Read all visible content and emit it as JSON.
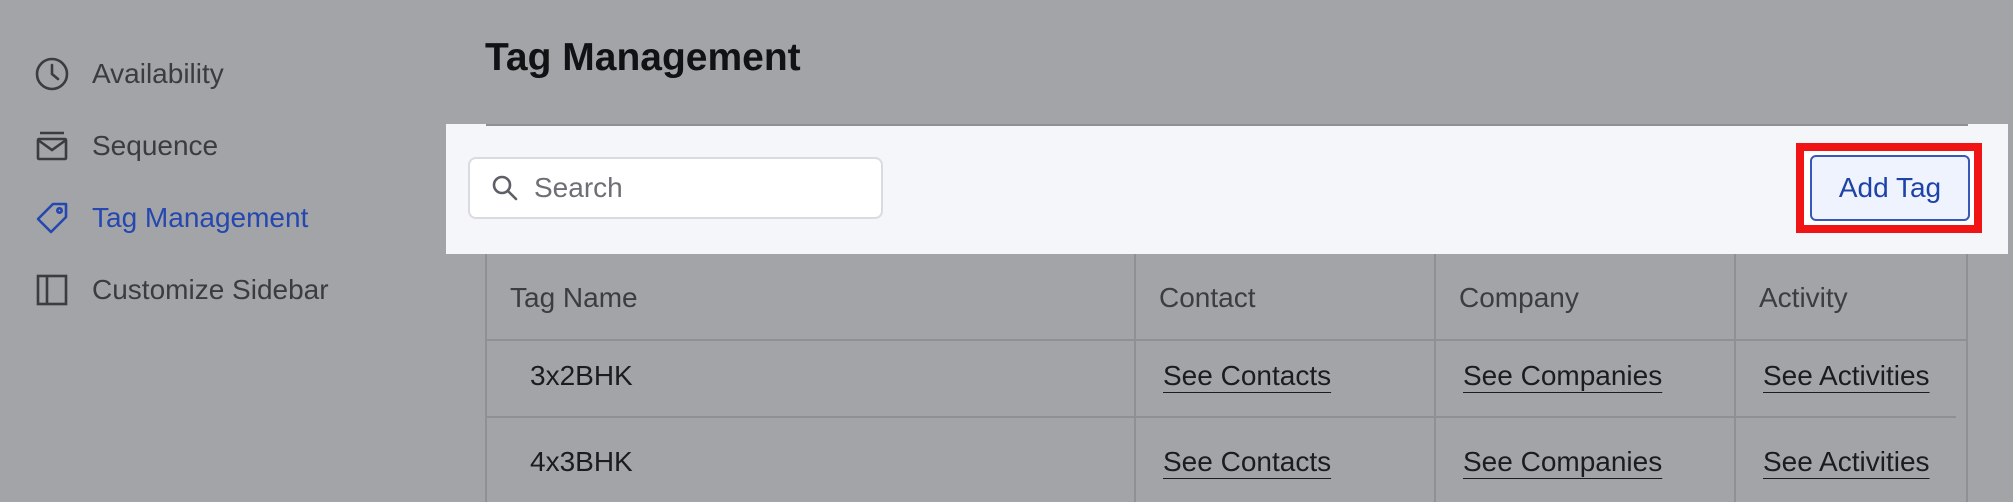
{
  "sidebar": {
    "items": [
      {
        "label": "Availability",
        "icon": "clock-icon",
        "active": false
      },
      {
        "label": "Sequence",
        "icon": "mail-tray-icon",
        "active": false
      },
      {
        "label": "Tag Management",
        "icon": "tag-icon",
        "active": true
      },
      {
        "label": "Customize Sidebar",
        "icon": "sidebar-layout-icon",
        "active": false
      }
    ]
  },
  "page": {
    "title": "Tag Management"
  },
  "toolbar": {
    "search_placeholder": "Search",
    "search_value": "",
    "add_tag_label": "Add Tag"
  },
  "table": {
    "columns": [
      "Tag Name",
      "Contact",
      "Company",
      "Activity"
    ],
    "rows": [
      {
        "tag": "3x2BHK",
        "contact": "See Contacts",
        "company": "See Companies",
        "activity": "See Activities"
      },
      {
        "tag": "4x3BHK",
        "contact": "See Contacts",
        "company": "See Companies",
        "activity": "See Activities"
      }
    ]
  },
  "colors": {
    "background": "#a3a4a7",
    "accent": "#2447b0",
    "toolbar_bg": "#f5f6fa",
    "highlight_border": "#f01414"
  }
}
